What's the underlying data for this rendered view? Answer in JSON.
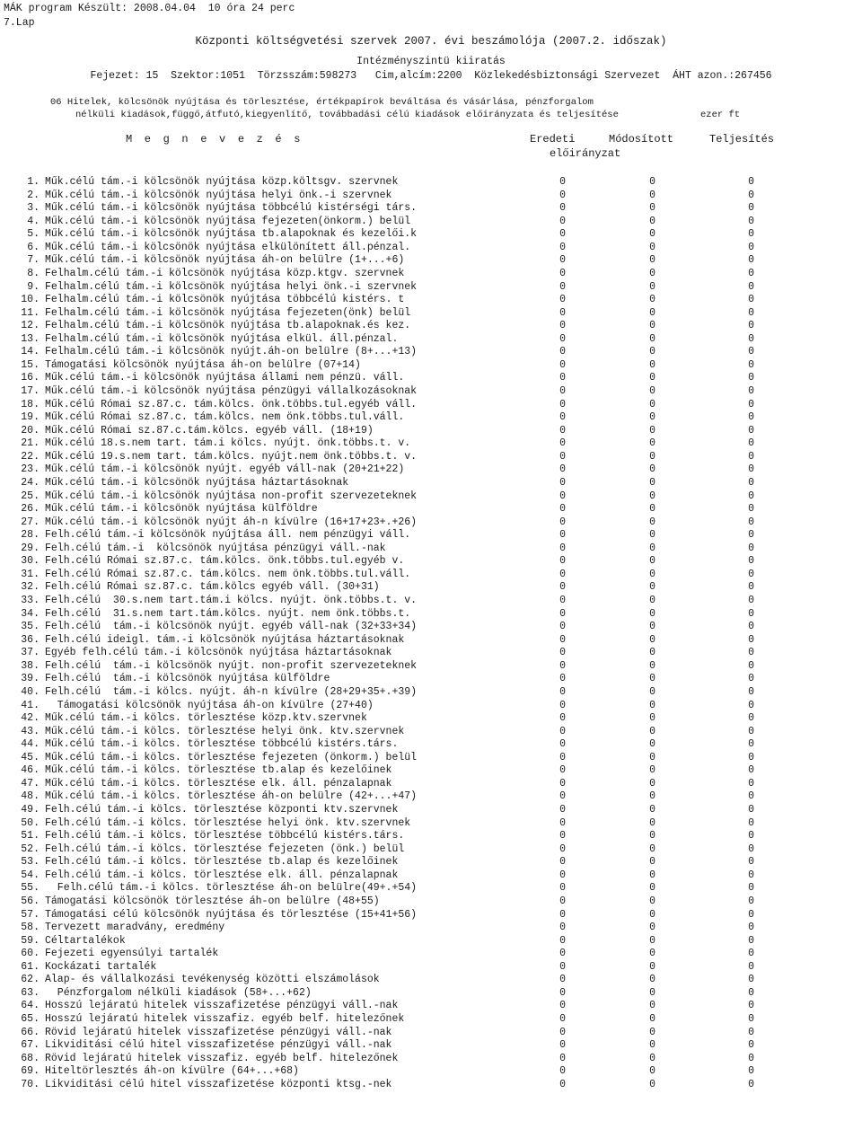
{
  "meta": {
    "program_line": "MÁK program Készült: 2008.04.04  10 óra 24 perc",
    "page_line": "7.Lap"
  },
  "header": {
    "title": "Központi költségvetési szervek 2007. évi beszámolója (2007.2. időszak)",
    "subtitle": "Intézményszintü kiiratás",
    "identifiers": "Fejezet: 15  Szektor:1051  Törzsszám:598273   Cim,alcím:2200  Közlekedésbiztonsági Szervezet  ÁHT azon.:267456"
  },
  "section": {
    "description_line1": "06 Hitelek, kölcsönök nyújtása és törlesztése, értékpapírok beváltása és vásárlása, pénzforgalom",
    "description_line2": "nélküli kiadások,függő,átfutó,kiegyenlítő, továbbadási célú kiadások előirányzata és teljesítése",
    "unit": "ezer ft"
  },
  "table": {
    "columns": {
      "label": "M e g n e v e z é s",
      "col1": "Eredeti",
      "col2": "Módosított",
      "col3": "Teljesítés",
      "col_sub": "előirányzat"
    },
    "rows": [
      {
        "num": "1.",
        "label": "Műk.célú tám.-i kölcsönök nyújtása közp.költsgv. szervnek",
        "v1": "0",
        "v2": "0",
        "v3": "0"
      },
      {
        "num": "2.",
        "label": "Műk.célú tám.-i kölcsönök nyújtása helyi önk.-i szervnek",
        "v1": "0",
        "v2": "0",
        "v3": "0"
      },
      {
        "num": "3.",
        "label": "Műk.célú tám.-i kölcsönök nyújtása többcélú kistérségi társ.",
        "v1": "0",
        "v2": "0",
        "v3": "0"
      },
      {
        "num": "4.",
        "label": "Műk.célú tám.-i kölcsönök nyújtása fejezeten(önkorm.) belül",
        "v1": "0",
        "v2": "0",
        "v3": "0"
      },
      {
        "num": "5.",
        "label": "Műk.célú tám.-i kölcsönök nyújtása tb.alapoknak és kezelői.k",
        "v1": "0",
        "v2": "0",
        "v3": "0"
      },
      {
        "num": "6.",
        "label": "Műk.célú tám.-i kölcsönök nyújtása elkülönített áll.pénzal.",
        "v1": "0",
        "v2": "0",
        "v3": "0"
      },
      {
        "num": "7.",
        "label": "Műk.célú tám.-i kölcsönök nyújtása áh-on belülre (1+...+6)",
        "v1": "0",
        "v2": "0",
        "v3": "0"
      },
      {
        "num": "8.",
        "label": "Felhalm.célú tám.-i kölcsönök nyújtása közp.ktgv. szervnek",
        "v1": "0",
        "v2": "0",
        "v3": "0"
      },
      {
        "num": "9.",
        "label": "Felhalm.célú tám.-i kölcsönök nyújtása helyi önk.-i szervnek",
        "v1": "0",
        "v2": "0",
        "v3": "0"
      },
      {
        "num": "10.",
        "label": "Felhalm.célú tám.-i kölcsönök nyújtása többcélú kistérs. t",
        "v1": "0",
        "v2": "0",
        "v3": "0"
      },
      {
        "num": "11.",
        "label": "Felhalm.célú tám.-i kölcsönök nyújtása fejezeten(önk) belül",
        "v1": "0",
        "v2": "0",
        "v3": "0"
      },
      {
        "num": "12.",
        "label": "Felhalm.célú tám.-i kölcsönök nyújtása tb.alapoknak.és kez.",
        "v1": "0",
        "v2": "0",
        "v3": "0"
      },
      {
        "num": "13.",
        "label": "Felhalm.célú tám.-i kölcsönök nyújtása elkül. áll.pénzal.",
        "v1": "0",
        "v2": "0",
        "v3": "0"
      },
      {
        "num": "14.",
        "label": "Felhalm.célú tám.-i kölcsönök nyújt.áh-on belülre (8+...+13)",
        "v1": "0",
        "v2": "0",
        "v3": "0"
      },
      {
        "num": "15.",
        "label": "Támogatási kölcsönök nyújtása áh-on belülre (07+14)",
        "v1": "0",
        "v2": "0",
        "v3": "0"
      },
      {
        "num": "16.",
        "label": "Műk.célú tám.-i kölcsönök nyújtása állami nem pénzü. váll.",
        "v1": "0",
        "v2": "0",
        "v3": "0"
      },
      {
        "num": "17.",
        "label": "Műk.célú tám.-i kölcsönök nyújtása pénzügyi vállalkozásoknak",
        "v1": "0",
        "v2": "0",
        "v3": "0"
      },
      {
        "num": "18.",
        "label": "Műk.célú Római sz.87.c. tám.kölcs. önk.többs.tul.egyéb váll.",
        "v1": "0",
        "v2": "0",
        "v3": "0"
      },
      {
        "num": "19.",
        "label": "Műk.célú Római sz.87.c. tám.kölcs. nem önk.többs.tul.váll.",
        "v1": "0",
        "v2": "0",
        "v3": "0"
      },
      {
        "num": "20.",
        "label": "Műk.célú Római sz.87.c.tám.kölcs. egyéb váll. (18+19)",
        "v1": "0",
        "v2": "0",
        "v3": "0"
      },
      {
        "num": "21.",
        "label": "Műk.célú 18.s.nem tart. tám.i kölcs. nyújt. önk.többs.t. v.",
        "v1": "0",
        "v2": "0",
        "v3": "0"
      },
      {
        "num": "22.",
        "label": "Műk.célú 19.s.nem tart. tám.kölcs. nyújt.nem önk.többs.t. v.",
        "v1": "0",
        "v2": "0",
        "v3": "0"
      },
      {
        "num": "23.",
        "label": "Műk.célú tám.-i kölcsönök nyújt. egyéb váll-nak (20+21+22)",
        "v1": "0",
        "v2": "0",
        "v3": "0"
      },
      {
        "num": "24.",
        "label": "Műk.célú tám.-i kölcsönök nyújtása háztartásoknak",
        "v1": "0",
        "v2": "0",
        "v3": "0"
      },
      {
        "num": "25.",
        "label": "Műk.célú tám.-i kölcsönök nyújtása non-profit szervezeteknek",
        "v1": "0",
        "v2": "0",
        "v3": "0"
      },
      {
        "num": "26.",
        "label": "Műk.célú tám.-i kölcsönök nyújtása külföldre",
        "v1": "0",
        "v2": "0",
        "v3": "0"
      },
      {
        "num": "27.",
        "label": "Műk.célú tám.-i kölcsönök nyújt áh-n kívülre (16+17+23+.+26)",
        "v1": "0",
        "v2": "0",
        "v3": "0"
      },
      {
        "num": "28.",
        "label": "Felh.célú tám.-i kölcsönök nyújtása áll. nem pénzügyi váll.",
        "v1": "0",
        "v2": "0",
        "v3": "0"
      },
      {
        "num": "29.",
        "label": "Felh.célú tám.-i  kölcsönök nyújtása pénzügyi váll.-nak",
        "v1": "0",
        "v2": "0",
        "v3": "0"
      },
      {
        "num": "30.",
        "label": "Felh.célú Római sz.87.c. tám.kölcs. önk.többs.tul.egyéb v.",
        "v1": "0",
        "v2": "0",
        "v3": "0"
      },
      {
        "num": "31.",
        "label": "Felh.célú Római sz.87.c. tám.kölcs. nem önk.többs.tul.váll.",
        "v1": "0",
        "v2": "0",
        "v3": "0"
      },
      {
        "num": "32.",
        "label": "Felh.célú Római sz.87.c. tám.kölcs egyéb váll. (30+31)",
        "v1": "0",
        "v2": "0",
        "v3": "0"
      },
      {
        "num": "33.",
        "label": "Felh.célú  30.s.nem tart.tám.i kölcs. nyújt. önk.többs.t. v.",
        "v1": "0",
        "v2": "0",
        "v3": "0"
      },
      {
        "num": "34.",
        "label": "Felh.célú  31.s.nem tart.tám.kölcs. nyújt. nem önk.többs.t.",
        "v1": "0",
        "v2": "0",
        "v3": "0"
      },
      {
        "num": "35.",
        "label": "Felh.célú  tám.-i kölcsönök nyújt. egyéb váll-nak (32+33+34)",
        "v1": "0",
        "v2": "0",
        "v3": "0"
      },
      {
        "num": "36.",
        "label": "Felh.célú ideigl. tám.-i kölcsönök nyújtása háztartásoknak",
        "v1": "0",
        "v2": "0",
        "v3": "0"
      },
      {
        "num": "37.",
        "label": "Egyéb felh.célú tám.-i kölcsönök nyújtása háztartásoknak",
        "v1": "0",
        "v2": "0",
        "v3": "0"
      },
      {
        "num": "38.",
        "label": "Felh.célú  tám.-i kölcsönök nyújt. non-profit szervezeteknek",
        "v1": "0",
        "v2": "0",
        "v3": "0"
      },
      {
        "num": "39.",
        "label": "Felh.célú  tám.-i kölcsönök nyújtása külföldre",
        "v1": "0",
        "v2": "0",
        "v3": "0"
      },
      {
        "num": "40.",
        "label": "Felh.célú  tám.-i kölcs. nyújt. áh-n kívülre (28+29+35+.+39)",
        "v1": "0",
        "v2": "0",
        "v3": "0"
      },
      {
        "num": "41.",
        "label": "  Támogatási kölcsönök nyújtása áh-on kívülre (27+40)",
        "v1": "0",
        "v2": "0",
        "v3": "0"
      },
      {
        "num": "42.",
        "label": "Műk.célú tám.-i kölcs. törlesztése közp.ktv.szervnek",
        "v1": "0",
        "v2": "0",
        "v3": "0"
      },
      {
        "num": "43.",
        "label": "Műk.célú tám.-i kölcs. törlesztése helyi önk. ktv.szervnek",
        "v1": "0",
        "v2": "0",
        "v3": "0"
      },
      {
        "num": "44.",
        "label": "Műk.célú tám.-i kölcs. törlesztése többcélú kistérs.társ.",
        "v1": "0",
        "v2": "0",
        "v3": "0"
      },
      {
        "num": "45.",
        "label": "Műk.célú tám.-i kölcs. törlesztése fejezeten (önkorm.) belül",
        "v1": "0",
        "v2": "0",
        "v3": "0"
      },
      {
        "num": "46.",
        "label": "Műk.célú tám.-i kölcs. törlesztése tb.alap és kezelőinek",
        "v1": "0",
        "v2": "0",
        "v3": "0"
      },
      {
        "num": "47.",
        "label": "Műk.célú tám.-i kölcs. törlesztése elk. áll. pénzalapnak",
        "v1": "0",
        "v2": "0",
        "v3": "0"
      },
      {
        "num": "48.",
        "label": "Műk.célú tám.-i kölcs. törlesztése áh-on belülre (42+...+47)",
        "v1": "0",
        "v2": "0",
        "v3": "0"
      },
      {
        "num": "49.",
        "label": "Felh.célú tám.-i kölcs. törlesztése központi ktv.szervnek",
        "v1": "0",
        "v2": "0",
        "v3": "0"
      },
      {
        "num": "50.",
        "label": "Felh.célú tám.-i kölcs. törlesztése helyi önk. ktv.szervnek",
        "v1": "0",
        "v2": "0",
        "v3": "0"
      },
      {
        "num": "51.",
        "label": "Felh.célú tám.-i kölcs. törlesztése többcélú kistérs.társ.",
        "v1": "0",
        "v2": "0",
        "v3": "0"
      },
      {
        "num": "52.",
        "label": "Felh.célú tám.-i kölcs. törlesztése fejezeten (önk.) belül",
        "v1": "0",
        "v2": "0",
        "v3": "0"
      },
      {
        "num": "53.",
        "label": "Felh.célú tám.-i kölcs. törlesztése tb.alap és kezelőinek",
        "v1": "0",
        "v2": "0",
        "v3": "0"
      },
      {
        "num": "54.",
        "label": "Felh.célú tám.-i kölcs. törlesztése elk. áll. pénzalapnak",
        "v1": "0",
        "v2": "0",
        "v3": "0"
      },
      {
        "num": "55.",
        "label": "  Felh.célú tám.-i kölcs. törlesztése áh-on belülre(49+.+54)",
        "v1": "0",
        "v2": "0",
        "v3": "0"
      },
      {
        "num": "56.",
        "label": "Támogatási kölcsönök törlesztése áh-on belülre (48+55)",
        "v1": "0",
        "v2": "0",
        "v3": "0"
      },
      {
        "num": "57.",
        "label": "Támogatási célú kölcsönök nyújtása és törlesztése (15+41+56)",
        "v1": "0",
        "v2": "0",
        "v3": "0"
      },
      {
        "num": "58.",
        "label": "Tervezett maradvány, eredmény",
        "v1": "0",
        "v2": "0",
        "v3": "0"
      },
      {
        "num": "59.",
        "label": "Céltartalékok",
        "v1": "0",
        "v2": "0",
        "v3": "0"
      },
      {
        "num": "60.",
        "label": "Fejezeti egyensúlyi tartalék",
        "v1": "0",
        "v2": "0",
        "v3": "0"
      },
      {
        "num": "61.",
        "label": "Kockázati tartalék",
        "v1": "0",
        "v2": "0",
        "v3": "0"
      },
      {
        "num": "62.",
        "label": "Alap- és vállalkozási tevékenység közötti elszámolások",
        "v1": "0",
        "v2": "0",
        "v3": "0"
      },
      {
        "num": "63.",
        "label": "  Pénzforgalom nélküli kiadások (58+...+62)",
        "v1": "0",
        "v2": "0",
        "v3": "0"
      },
      {
        "num": "64.",
        "label": "Hosszú lejáratú hitelek visszafizetése pénzügyi váll.-nak",
        "v1": "0",
        "v2": "0",
        "v3": "0"
      },
      {
        "num": "65.",
        "label": "Hosszú lejáratú hitelek visszafiz. egyéb belf. hitelezőnek",
        "v1": "0",
        "v2": "0",
        "v3": "0"
      },
      {
        "num": "66.",
        "label": "Rövid lejáratú hitelek visszafizetése pénzügyi váll.-nak",
        "v1": "0",
        "v2": "0",
        "v3": "0"
      },
      {
        "num": "67.",
        "label": "Likviditási célú hitel visszafizetése pénzügyi váll.-nak",
        "v1": "0",
        "v2": "0",
        "v3": "0"
      },
      {
        "num": "68.",
        "label": "Rövid lejáratú hitelek visszafiz. egyéb belf. hitelezőnek",
        "v1": "0",
        "v2": "0",
        "v3": "0"
      },
      {
        "num": "69.",
        "label": "Hiteltörlesztés áh-on kívülre (64+...+68)",
        "v1": "0",
        "v2": "0",
        "v3": "0"
      },
      {
        "num": "70.",
        "label": "Likviditási célú hitel visszafizetése központi ktsg.-nek",
        "v1": "0",
        "v2": "0",
        "v3": "0"
      }
    ]
  }
}
